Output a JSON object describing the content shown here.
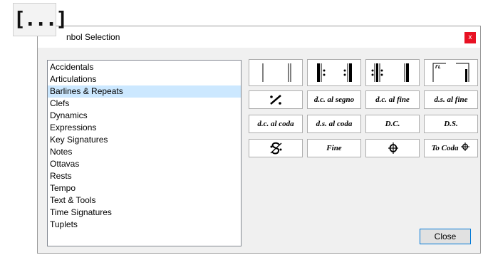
{
  "window": {
    "title": "nbol Selection",
    "close_glyph": "x"
  },
  "app_icon": {
    "glyph": "[...]",
    "icon": "ellipsis-bracket-icon"
  },
  "categories": [
    "Accidentals",
    "Articulations",
    "Barlines & Repeats",
    "Clefs",
    "Dynamics",
    "Expressions",
    "Key Signatures",
    "Notes",
    "Ottavas",
    "Rests",
    "Tempo",
    "Text & Tools",
    "Time Signatures",
    "Tuplets"
  ],
  "selected_category": "Barlines & Repeats",
  "symbols": {
    "row1": [
      "single-barline-icon",
      "double-barline-icon",
      "start-repeat-icon",
      "end-repeat-icon",
      "double-repeat-icon",
      "final-barline-icon",
      "first-ending-icon",
      "second-ending-icon"
    ],
    "simile": "simile-icon",
    "dc_al_segno": "d.c. al segno",
    "dc_al_fine": "d.c. al fine",
    "ds_al_fine": "d.s. al fine",
    "dc_al_coda": "d.c. al coda",
    "ds_al_coda": "d.s. al coda",
    "dc": "D.C.",
    "ds": "D.S.",
    "segno": "segno-icon",
    "fine": "Fine",
    "coda": "coda-icon",
    "to_coda": "To Coda"
  },
  "buttons": {
    "close": "Close"
  }
}
